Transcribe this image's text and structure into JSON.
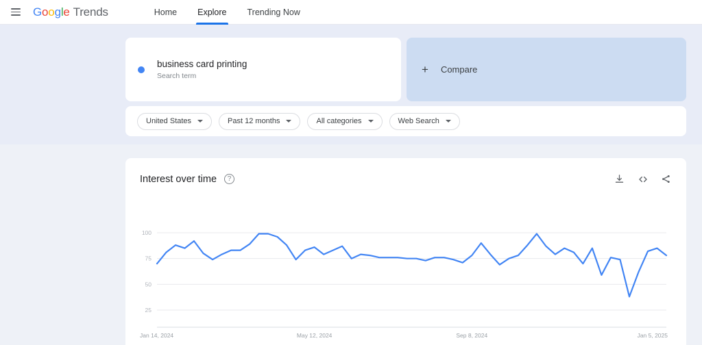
{
  "header": {
    "menu_icon": "hamburger-icon",
    "logo": {
      "g1": "G",
      "o1": "o",
      "o2": "o",
      "g2": "g",
      "l": "l",
      "e": "e",
      "product": "Trends"
    },
    "nav": [
      {
        "label": "Home",
        "active": false
      },
      {
        "label": "Explore",
        "active": true
      },
      {
        "label": "Trending Now",
        "active": false
      }
    ]
  },
  "search_terms": {
    "term": {
      "name": "business card printing",
      "type_label": "Search term",
      "color": "#4285F4"
    },
    "compare": {
      "label": "Compare",
      "icon": "plus-icon"
    }
  },
  "filters": [
    {
      "label": "United States",
      "name": "region"
    },
    {
      "label": "Past 12 months",
      "name": "time-range"
    },
    {
      "label": "All categories",
      "name": "category"
    },
    {
      "label": "Web Search",
      "name": "search-type"
    }
  ],
  "interest_card": {
    "title": "Interest over time",
    "help_glyph": "?",
    "actions": [
      {
        "name": "download-icon",
        "tip": "Download"
      },
      {
        "name": "embed-icon",
        "tip": "Embed"
      },
      {
        "name": "share-icon",
        "tip": "Share"
      }
    ]
  },
  "chart_data": {
    "type": "line",
    "title": "Interest over time",
    "xlabel": "",
    "ylabel": "",
    "ylim": [
      0,
      107
    ],
    "yticks": [
      100,
      75,
      50,
      25
    ],
    "grid": true,
    "legend": false,
    "line_color": "#4285F4",
    "xtick_labels": [
      "Jan 14, 2024",
      "May 12, 2024",
      "Sep 8, 2024",
      "Jan 5, 2025"
    ],
    "xtick_indices": [
      0,
      17,
      34,
      51
    ],
    "series": [
      {
        "name": "business card printing",
        "values": [
          70,
          81,
          88,
          85,
          92,
          80,
          74,
          79,
          83,
          83,
          89,
          99,
          99,
          96,
          88,
          74,
          83,
          86,
          79,
          83,
          87,
          75,
          79,
          78,
          76,
          76,
          76,
          75,
          75,
          73,
          76,
          76,
          74,
          71,
          78,
          90,
          79,
          69,
          75,
          78,
          88,
          99,
          87,
          79,
          85,
          81,
          70,
          85,
          59,
          76,
          74,
          38,
          62,
          82,
          85,
          78
        ]
      }
    ]
  }
}
